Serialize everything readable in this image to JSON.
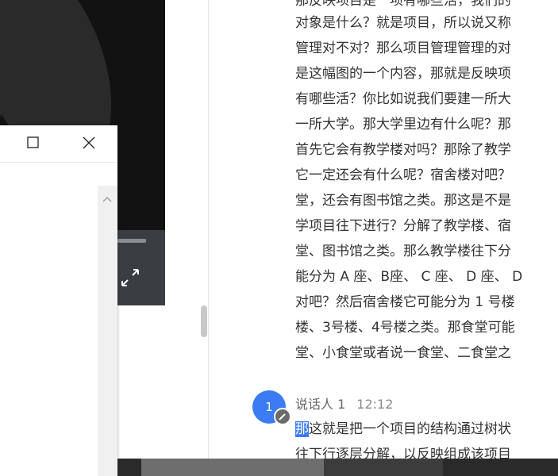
{
  "dialog": {
    "maximize_icon": "maximize-icon",
    "close_icon": "close-icon"
  },
  "video": {
    "fullscreen_icon": "expand-icon"
  },
  "transcript": {
    "lines": [
      "那反映项目是一项有哪些活，我们的",
      "对象是什么？就是项目，所以说又称",
      "管理对不对？那么项目管理管理的对",
      "是这幅图的一个内容，那就是反映项",
      "有哪些活？你比如说我们要建一所大",
      "一所大学。那大学里边有什么呢？那",
      "首先它会有教学楼对吗？那除了教学",
      "它一定还会有什么呢？宿舍楼对吧？",
      "堂，还会有图书馆之类。那这是不是",
      "学项目往下进行？分解了教学楼、宿",
      "堂、图书馆之类。那么教学楼往下分",
      "能分为 A 座、B座、 C 座、 D 座、 D",
      "对吧？然后宿舍楼它可能分为 1 号楼",
      "楼、3号楼、4号楼之类。那食堂可能",
      "堂、小食堂或者说一食堂、二食堂之"
    ],
    "speaker": {
      "avatar_text": "1",
      "name": "说话人 1",
      "time": "12:12"
    },
    "highlight_word": "那",
    "second_block_line1_rest": "这就是把一个项目的结构通过树状",
    "second_block_line2": "往下行逐层分解，以反映组成该项目"
  }
}
